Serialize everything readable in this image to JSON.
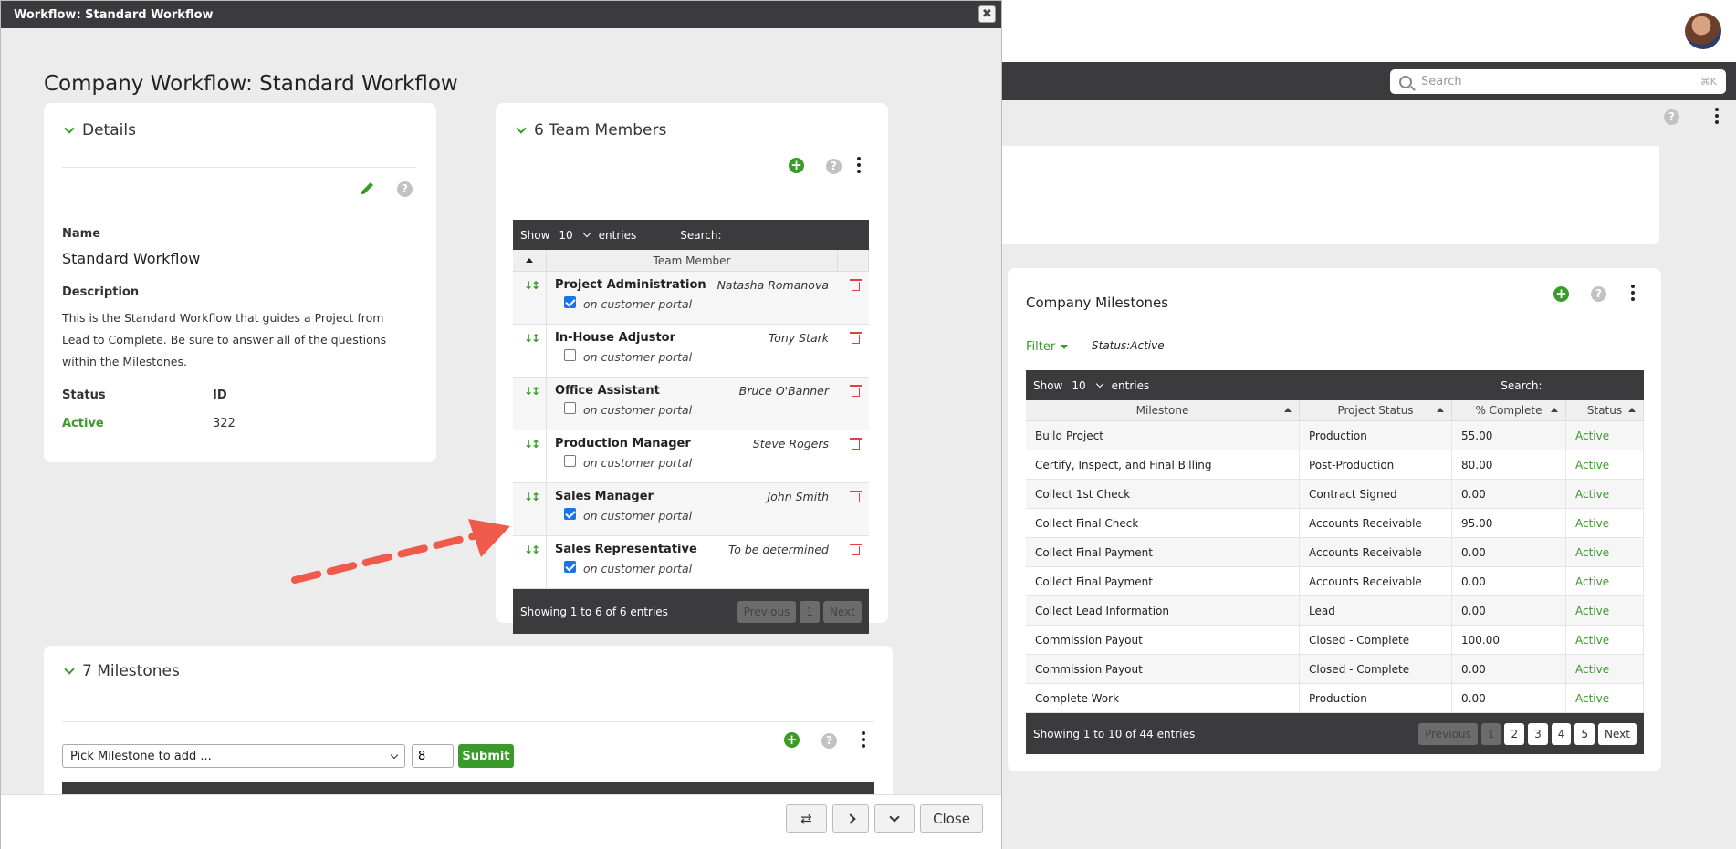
{
  "modal": {
    "titlebar": "Workflow: Standard Workflow",
    "close_glyph": "✖",
    "page_title": "Company Workflow: Standard Workflow"
  },
  "details": {
    "heading": "Details",
    "name_label": "Name",
    "name_value": "Standard Workflow",
    "description_label": "Description",
    "description_value": "This is the Standard Workflow that guides a Project from Lead to Complete. Be sure to answer all of the questions within the Milestones.",
    "status_label": "Status",
    "status_value": "Active",
    "id_label": "ID",
    "id_value": "322",
    "edit_icon": "pencil-icon",
    "help_icon": "help-icon"
  },
  "team": {
    "heading": "6 Team Members",
    "show_label": "Show",
    "show_value": "10",
    "entries_label": "entries",
    "search_label": "Search:",
    "column": "Team Member",
    "portal_label": "on customer portal",
    "rows": [
      {
        "role": "Project Administration",
        "person": "Natasha Romanova",
        "portal": true
      },
      {
        "role": "In-House Adjustor",
        "person": "Tony Stark",
        "portal": false
      },
      {
        "role": "Office Assistant",
        "person": "Bruce O'Banner",
        "portal": false
      },
      {
        "role": "Production Manager",
        "person": "Steve Rogers",
        "portal": false
      },
      {
        "role": "Sales Manager",
        "person": "John Smith",
        "portal": true
      },
      {
        "role": "Sales Representative",
        "person": "To be determined",
        "portal": true
      }
    ],
    "showing": "Showing 1 to 6 of 6 entries",
    "previous": "Previous",
    "page": "1",
    "next": "Next"
  },
  "milestones": {
    "heading": "7 Milestones",
    "select_placeholder": "Pick Milestone to add ...",
    "qty_value": "8",
    "submit": "Submit"
  },
  "footer": {
    "close": "Close",
    "swap_icon": "swap-icon",
    "next_icon": "chevron-right-icon",
    "down_icon": "chevron-down-icon"
  },
  "background": {
    "search_placeholder": "Search",
    "search_shortcut": "⌘K",
    "company_milestones": {
      "title": "Company Milestones",
      "filter_label": "Filter",
      "filter_status": "Status:Active",
      "show_label": "Show",
      "show_value": "10",
      "entries_label": "entries",
      "search_label": "Search:",
      "columns": [
        "Milestone",
        "Project Status",
        "% Complete",
        "Status"
      ],
      "rows": [
        [
          "Build Project",
          "Production",
          "55.00",
          "Active"
        ],
        [
          "Certify, Inspect, and Final Billing",
          "Post-Production",
          "80.00",
          "Active"
        ],
        [
          "Collect 1st Check",
          "Contract Signed",
          "0.00",
          "Active"
        ],
        [
          "Collect Final Check",
          "Accounts Receivable",
          "95.00",
          "Active"
        ],
        [
          "Collect Final Payment",
          "Accounts Receivable",
          "0.00",
          "Active"
        ],
        [
          "Collect Final Payment",
          "Accounts Receivable",
          "0.00",
          "Active"
        ],
        [
          "Collect Lead Information",
          "Lead",
          "0.00",
          "Active"
        ],
        [
          "Commission Payout",
          "Closed - Complete",
          "100.00",
          "Active"
        ],
        [
          "Commission Payout",
          "Closed - Complete",
          "0.00",
          "Active"
        ],
        [
          "Complete Work",
          "Production",
          "0.00",
          "Active"
        ]
      ],
      "showing": "Showing 1 to 10 of 44 entries",
      "pager": [
        "Previous",
        "1",
        "2",
        "3",
        "4",
        "5",
        "Next"
      ]
    }
  },
  "colors": {
    "accent_green": "#3a9a2a",
    "dark_bar": "#3b3b3d",
    "danger_red": "#e04040",
    "annotation_arrow": "#ef5a4a"
  }
}
